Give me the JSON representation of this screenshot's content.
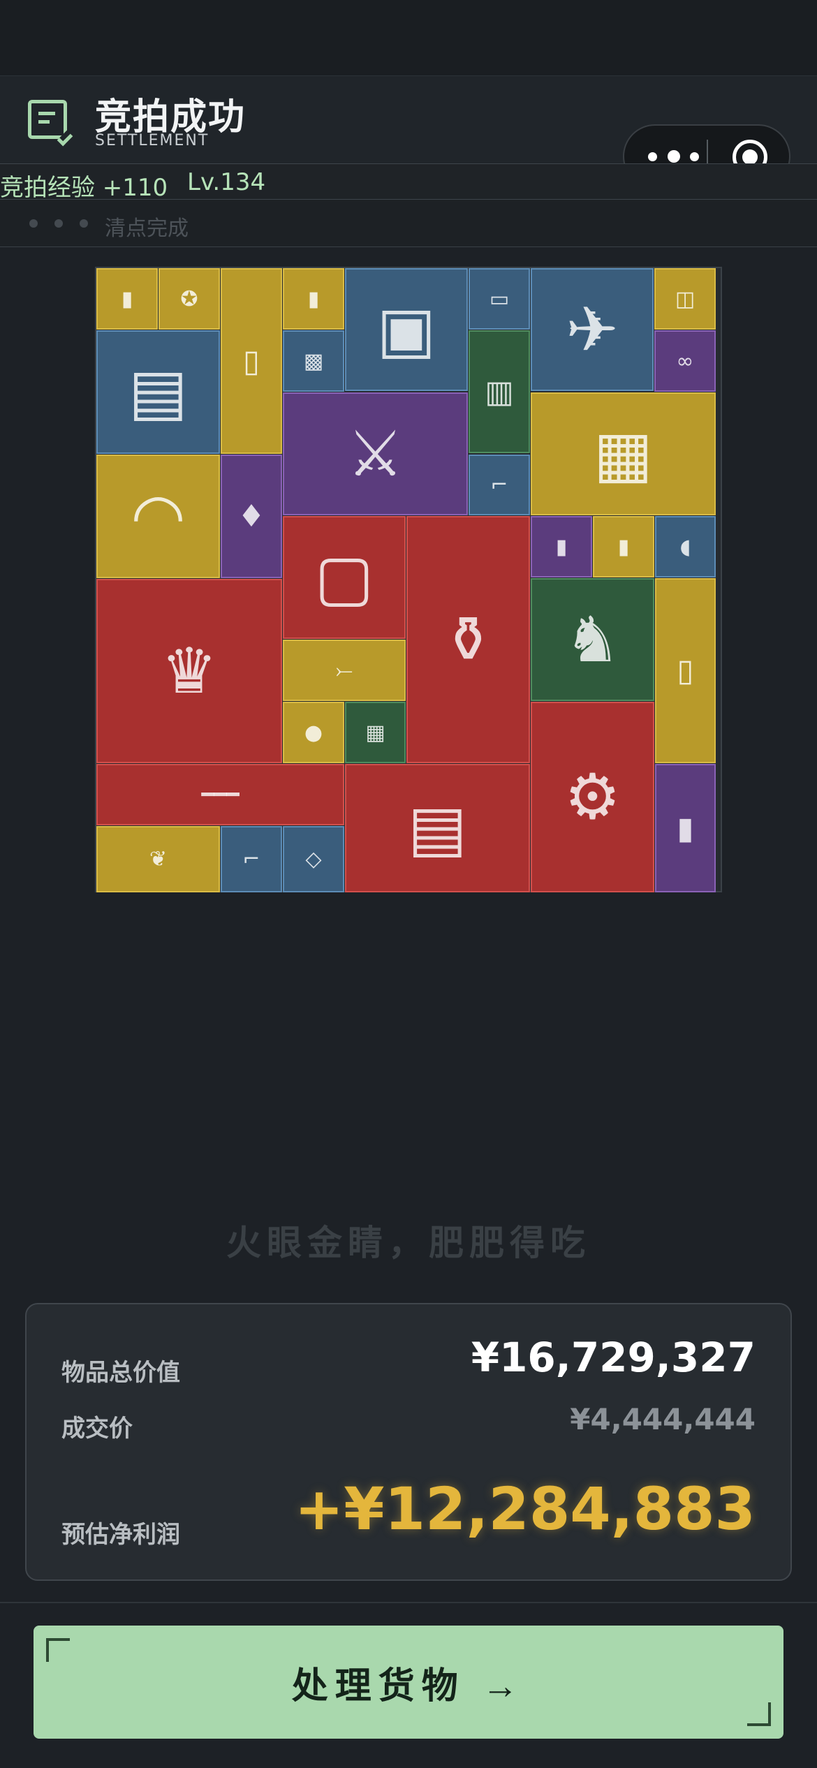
{
  "header": {
    "title": "竞拍成功",
    "subtitle": "SETTLEMENT",
    "icon": "settlement-list-icon"
  },
  "capsule": {
    "menu_icon": "more-dots-icon",
    "close_icon": "target-close-icon"
  },
  "progress": {
    "xp_text": "竞拍经验 +110",
    "level_text": "Lv.134"
  },
  "status": {
    "text": "清点完成"
  },
  "colors": {
    "gold": "#b89a2a",
    "blue": "#3a5d7c",
    "purple": "#5b3c7d",
    "red": "#a8302f",
    "green": "#2f5a3c",
    "accent": "#a9d8ad",
    "profit": "#e4b63c"
  },
  "items": [
    {
      "rarity": "gold",
      "icon": "bottle-icon"
    },
    {
      "rarity": "gold",
      "icon": "medal-icon"
    },
    {
      "rarity": "gold",
      "icon": "gas-cylinder-icon"
    },
    {
      "rarity": "gold",
      "icon": "bottle-icon"
    },
    {
      "rarity": "blue",
      "icon": "paint-can-icon"
    },
    {
      "rarity": "blue",
      "icon": "music-player-icon"
    },
    {
      "rarity": "blue",
      "icon": "drone-icon"
    },
    {
      "rarity": "gold",
      "icon": "floppy-disk-icon"
    },
    {
      "rarity": "blue",
      "icon": "magazine-icon"
    },
    {
      "rarity": "blue",
      "icon": "tea-box-icon"
    },
    {
      "rarity": "green",
      "icon": "fire-extinguisher-box-icon"
    },
    {
      "rarity": "purple",
      "icon": "binoculars-icon"
    },
    {
      "rarity": "purple",
      "icon": "knife-icon"
    },
    {
      "rarity": "gold",
      "icon": "radio-station-icon"
    },
    {
      "rarity": "blue",
      "icon": "thermometer-gun-icon"
    },
    {
      "rarity": "gold",
      "icon": "headset-icon"
    },
    {
      "rarity": "purple",
      "icon": "lantern-icon"
    },
    {
      "rarity": "red",
      "icon": "tablet-device-icon"
    },
    {
      "rarity": "red",
      "icon": "vase-icon"
    },
    {
      "rarity": "purple",
      "icon": "walkie-talkie-icon"
    },
    {
      "rarity": "gold",
      "icon": "bottle-icon"
    },
    {
      "rarity": "blue",
      "icon": "pill-bottle-icon"
    },
    {
      "rarity": "red",
      "icon": "crown-icon"
    },
    {
      "rarity": "green",
      "icon": "sphinx-statue-icon"
    },
    {
      "rarity": "gold",
      "icon": "gas-cylinder-icon"
    },
    {
      "rarity": "gold",
      "icon": "crossbow-icon"
    },
    {
      "rarity": "gold",
      "icon": "pearls-icon"
    },
    {
      "rarity": "green",
      "icon": "cpu-cooler-icon"
    },
    {
      "rarity": "red",
      "icon": "robot-icon"
    },
    {
      "rarity": "red",
      "icon": "rifle-icon"
    },
    {
      "rarity": "red",
      "icon": "ammo-crate-icon"
    },
    {
      "rarity": "purple",
      "icon": "blowtorch-icon"
    },
    {
      "rarity": "gold",
      "icon": "laurel-wreath-icon"
    },
    {
      "rarity": "blue",
      "icon": "thermometer-gun-icon"
    },
    {
      "rarity": "blue",
      "icon": "metal-plate-icon"
    }
  ],
  "slogan": "火眼金睛，肥肥得吃",
  "summary": {
    "total_label": "物品总价值",
    "total_value": "¥16,729,327",
    "deal_label": "成交价",
    "deal_value": "¥4,444,444",
    "profit_label": "预估净利润",
    "profit_value": "+¥12,284,883"
  },
  "action": {
    "label": "处理货物 →"
  }
}
